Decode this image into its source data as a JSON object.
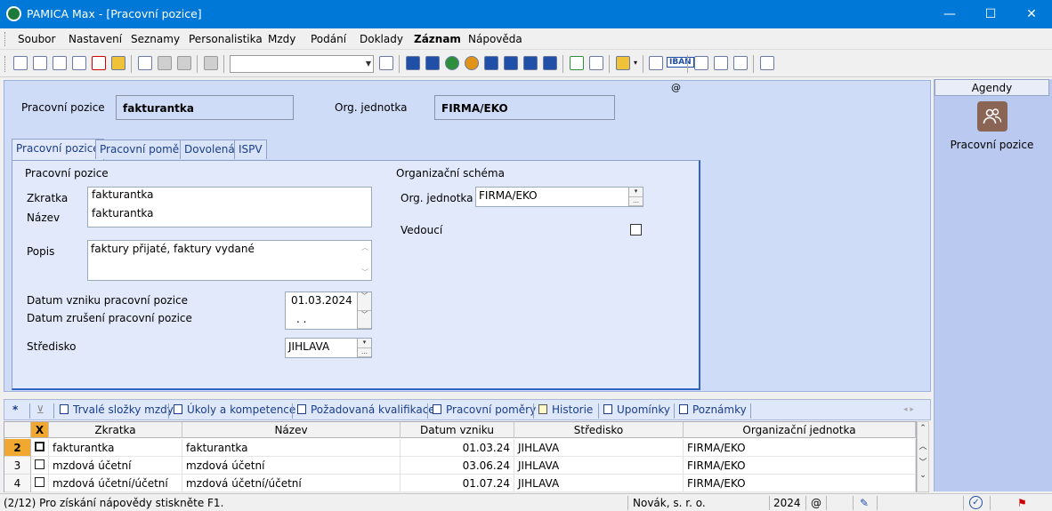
{
  "window": {
    "title": "PAMICA Max - [Pracovní pozice]",
    "minimize": "—",
    "maximize": "☐",
    "close": "✕"
  },
  "menu": [
    "Soubor",
    "Nastavení",
    "Seznamy",
    "Personalistika",
    "Mzdy",
    "Podání",
    "Doklady",
    "Záznam",
    "Nápověda"
  ],
  "toolbar": {
    "combo_value": "",
    "iban_label": "IBAN"
  },
  "header": {
    "position_label": "Pracovní pozice",
    "position_value": "fakturantka",
    "org_label": "Org. jednotka",
    "org_value": "FIRMA/EKO",
    "at_sign": "@"
  },
  "tabs": [
    "Pracovní pozice",
    "Pracovní poměr",
    "Dovolená",
    "ISPV"
  ],
  "form": {
    "group_title": "Pracovní pozice",
    "zkratka_label": "Zkratka",
    "zkratka_value": "fakturantka",
    "nazev_label": "Název",
    "nazev_value": "fakturantka",
    "popis_label": "Popis",
    "popis_value": "faktury přijaté, faktury vydané",
    "datum_vzniku_label": "Datum vzniku pracovní pozice",
    "datum_vzniku_value": "01.03.2024",
    "datum_zruseni_label": "Datum zrušení pracovní pozice",
    "datum_zruseni_value": ". .",
    "stredisko_label": "Středisko",
    "stredisko_value": "JIHLAVA",
    "org_group_title": "Organizační schéma",
    "org_jednotka_label": "Org. jednotka",
    "org_jednotka_value": "FIRMA/EKO",
    "vedouci_label": "Vedoucí",
    "vedouci_checked": false
  },
  "agenda": {
    "header": "Agendy",
    "item_label": "Pracovní pozice"
  },
  "bottom_tabs": {
    "star": "*",
    "items": [
      "Trvalé složky mzdy",
      "Úkoly a kompetence",
      "Požadovaná kvalifikace",
      "Pracovní poměry",
      "Historie",
      "Upomínky",
      "Poznámky"
    ],
    "nav_arrows": "◂ ▸"
  },
  "grid": {
    "corner": "X",
    "columns": [
      "Zkratka",
      "Název",
      "Datum vzniku",
      "Středisko",
      "Organizační jednotka"
    ],
    "rows": [
      {
        "num": "2",
        "zkratka": "fakturantka",
        "nazev": "fakturantka",
        "datum": "01.03.24",
        "stredisko": "JIHLAVA",
        "org": "FIRMA/EKO",
        "active": true
      },
      {
        "num": "3",
        "zkratka": "mzdová účetní",
        "nazev": "mzdová účetní",
        "datum": "03.06.24",
        "stredisko": "JIHLAVA",
        "org": "FIRMA/EKO",
        "active": false
      },
      {
        "num": "4",
        "zkratka": "mzdová účetní/účetní",
        "nazev": "mzdová účetní/účetní",
        "datum": "01.07.24",
        "stredisko": "JIHLAVA",
        "org": "FIRMA/EKO",
        "active": false
      }
    ]
  },
  "status": {
    "help": "(2/12) Pro získání nápovědy stiskněte F1.",
    "company": "Novák, s. r. o.",
    "year": "2024",
    "at_sign": "@"
  },
  "colors": {
    "titlebar": "#0078d7",
    "panel": "#cfdcf8",
    "agenda": "#b9c9ef",
    "active_row": "#f0a830"
  }
}
